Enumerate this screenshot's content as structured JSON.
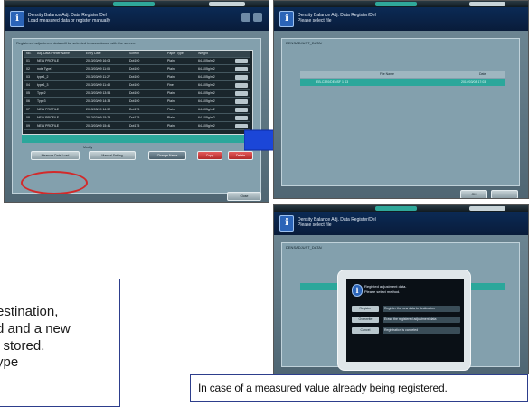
{
  "screen1": {
    "header_line1": "Density Balance Adj. Data Register/Del",
    "header_line2": "Load measured data or register manually",
    "panel_title": "Registered adjustment data will be selected in accordance with the screen.",
    "columns": [
      "No.",
      "Adj. Data Printer Name",
      "Entry Date",
      "Screen",
      "Paper Type",
      "Weight"
    ],
    "rows": [
      {
        "no": "01",
        "name": "NEW PROFILE",
        "date": "2013/03/09 16:03",
        "screen": "Dot190",
        "paper": "Plain",
        "weight": "64-105g/m2"
      },
      {
        "no": "02",
        "name": "note Type1",
        "date": "2013/03/09 11:05",
        "screen": "Dot190",
        "paper": "Plain",
        "weight": "64-105g/m2"
      },
      {
        "no": "03",
        "name": "type1_2",
        "date": "2013/03/09 11:27",
        "screen": "Dot190",
        "paper": "Plain",
        "weight": "64-105g/m2"
      },
      {
        "no": "04",
        "name": "type1_3",
        "date": "2013/03/09 11:48",
        "screen": "Dot190",
        "paper": "Fine",
        "weight": "64-105g/m2"
      },
      {
        "no": "05",
        "name": "Type2",
        "date": "2013/03/09 13:54",
        "screen": "Dot190",
        "paper": "Plain",
        "weight": "64-105g/m2"
      },
      {
        "no": "06",
        "name": "Type3",
        "date": "2013/03/09 14:38",
        "screen": "Dot190",
        "paper": "Plain",
        "weight": "64-105g/m2"
      },
      {
        "no": "07",
        "name": "NEW PROFILE",
        "date": "2013/03/09 14:52",
        "screen": "Dot175",
        "paper": "Plain",
        "weight": "64-105g/m2"
      },
      {
        "no": "08",
        "name": "NEW PROFILE",
        "date": "2013/03/09 15:29",
        "screen": "Dot175",
        "paper": "Plain",
        "weight": "64-105g/m2"
      },
      {
        "no": "09",
        "name": "NEW PROFILE",
        "date": "2013/03/09 15:41",
        "screen": "Dot175",
        "paper": "Plain",
        "weight": "64-105g/m2"
      }
    ],
    "btn_measure": "Measure Data Load",
    "section_label": "Modify",
    "btn_manual": "Manual Setting",
    "btn_change": "Change Name",
    "btn_copy": "Copy",
    "btn_delete": "Delete",
    "btn_close": "Close"
  },
  "screen2": {
    "header_line1": "Density Balance Adj. Data Register/Del",
    "header_line2": "Please select file",
    "panel_title": "DENSADJUST_DATA/",
    "col_name": "File Name",
    "col_date": "Date",
    "selected_file": "EB-C320/DENSF 1 S3",
    "selected_date": "2014/03/08 17:03",
    "btn_ok": "OK"
  },
  "screen3": {
    "header_line1": "Density Balance Adj. Data Register/Del",
    "header_line2": "Please select file",
    "panel_title": "DENSADJUST_DATA/",
    "dlg_line1": "Registed adjustment data.",
    "dlg_line2": "Please select method.",
    "opt1_btn": "Register",
    "opt1_text": "Register the new data to destination",
    "opt2_btn": "Overwrite",
    "opt2_text": "Erase the registered adjustment data",
    "opt3_btn": "Cancel",
    "opt3_text": "Registration is canceled"
  },
  "left_text_lines": [
    "estination,",
    "d and a new",
    "l stored.",
    "ype"
  ],
  "caption": "In case of a measured value already being registered."
}
